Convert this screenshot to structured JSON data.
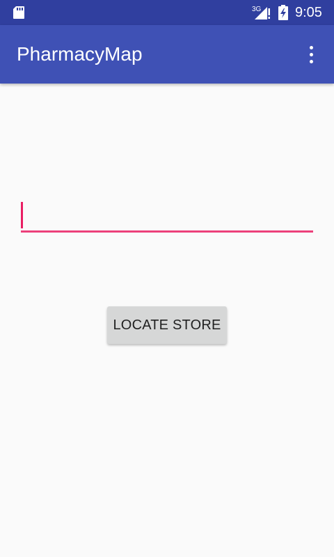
{
  "status_bar": {
    "network_type": "3G",
    "time": "9:05",
    "icons": [
      "sd-card-icon",
      "signal-icon",
      "battery-icon"
    ]
  },
  "app_bar": {
    "title": "PharmacyMap",
    "menu_icon": "overflow-menu-icon"
  },
  "store_input": {
    "value": "",
    "placeholder": ""
  },
  "locate_button": {
    "label": "LOCATE STORE"
  },
  "colors": {
    "status_bar": "#303f9f",
    "app_bar": "#3f51b5",
    "accent": "#ec407a",
    "button": "#d6d7d7",
    "background": "#fafafa"
  }
}
